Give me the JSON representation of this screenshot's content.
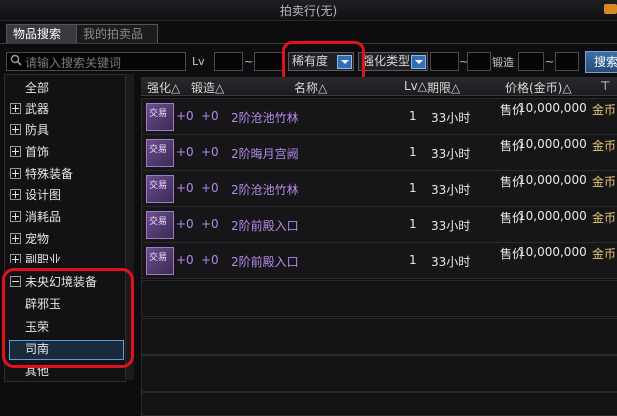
{
  "window": {
    "title": "拍卖行(无)"
  },
  "tabs": [
    {
      "label": "物品搜索",
      "active": true
    },
    {
      "label": "我的拍卖品",
      "active": false
    }
  ],
  "filters": {
    "search_placeholder": "请输入搜索关键词",
    "lv_label": "Lv",
    "tilde": "~",
    "rarity_dropdown": "稀有度",
    "enhance_type_dropdown": "强化类型",
    "forge_label": "锻造",
    "search_button": "搜索"
  },
  "categories": [
    {
      "label": "全部",
      "expander": "none"
    },
    {
      "label": "武器",
      "expander": "plus"
    },
    {
      "label": "防具",
      "expander": "plus"
    },
    {
      "label": "首饰",
      "expander": "plus"
    },
    {
      "label": "特殊装备",
      "expander": "plus"
    },
    {
      "label": "设计图",
      "expander": "plus"
    },
    {
      "label": "消耗品",
      "expander": "plus"
    },
    {
      "label": "宠物",
      "expander": "plus"
    },
    {
      "label": "副职业",
      "expander": "plus"
    },
    {
      "label": "未央幻境装备",
      "expander": "minus"
    }
  ],
  "subcategories": [
    {
      "label": "辟邪玉",
      "selected": false
    },
    {
      "label": "玉荣",
      "selected": false
    },
    {
      "label": "司南",
      "selected": true
    },
    {
      "label": "其他",
      "selected": false
    }
  ],
  "table": {
    "headers": [
      "强化△",
      "锻造△",
      "名称△",
      "Lv△",
      "期限△",
      "价格(金币)△"
    ],
    "rows": [
      {
        "icon_text": "交易",
        "enhance": "+0",
        "forge": "+0",
        "name": "2阶沧池竹林",
        "lv": "1",
        "term": "33小时",
        "price_label": "售价",
        "price": "10,000,000",
        "unit": "金币"
      },
      {
        "icon_text": "交易",
        "enhance": "+0",
        "forge": "+0",
        "name": "2阶晦月宫阙",
        "lv": "1",
        "term": "33小时",
        "price_label": "售价",
        "price": "10,000,000",
        "unit": "金币"
      },
      {
        "icon_text": "交易",
        "enhance": "+0",
        "forge": "+0",
        "name": "2阶沧池竹林",
        "lv": "1",
        "term": "33小时",
        "price_label": "售价",
        "price": "10,000,000",
        "unit": "金币"
      },
      {
        "icon_text": "交易",
        "enhance": "+0",
        "forge": "+0",
        "name": "2阶前殿入口",
        "lv": "1",
        "term": "33小时",
        "price_label": "售价",
        "price": "10,000,000",
        "unit": "金币"
      },
      {
        "icon_text": "交易",
        "enhance": "+0",
        "forge": "+0",
        "name": "2阶前殿入口",
        "lv": "1",
        "term": "33小时",
        "price_label": "售价",
        "price": "10,000,000",
        "unit": "金币"
      }
    ]
  },
  "colors": {
    "highlight_red": "#e0121a",
    "item_name": "#b48ae8",
    "accent_blue": "#2f6fb6"
  }
}
